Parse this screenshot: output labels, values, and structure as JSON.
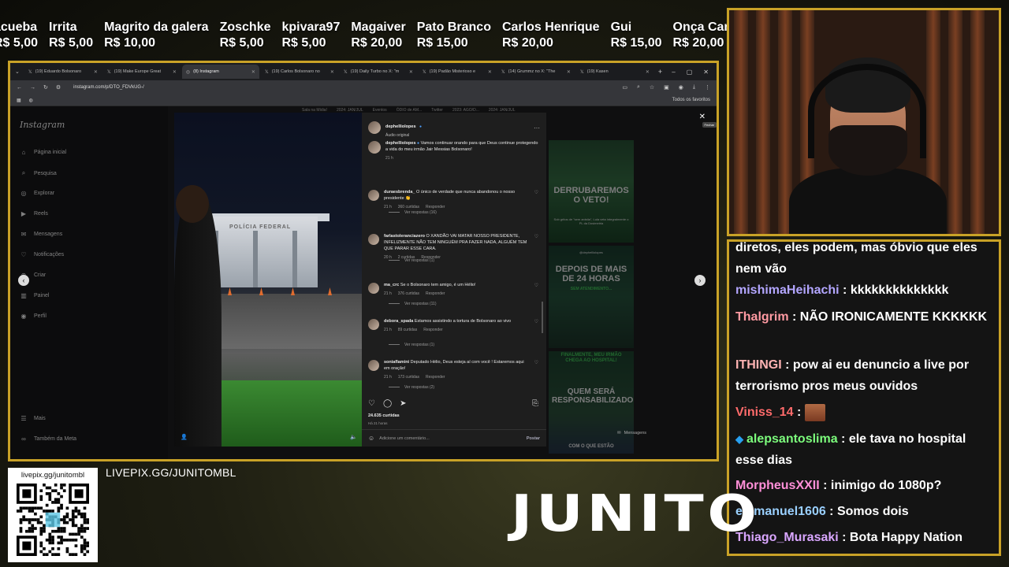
{
  "ticker": [
    {
      "name": "acueba",
      "amount": "R$ 5,00"
    },
    {
      "name": "Irrita",
      "amount": "R$ 5,00"
    },
    {
      "name": "Magrito da galera",
      "amount": "R$ 10,00"
    },
    {
      "name": "Zoschke",
      "amount": "R$ 5,00"
    },
    {
      "name": "kpivara97",
      "amount": "R$ 5,00"
    },
    {
      "name": "Magaiver",
      "amount": "R$ 20,00"
    },
    {
      "name": "Pato Branco",
      "amount": "R$ 15,00"
    },
    {
      "name": "Carlos Henrique",
      "amount": "R$ 20,00"
    },
    {
      "name": "Gui",
      "amount": "R$ 15,00"
    },
    {
      "name": "Onça Canader",
      "amount": "R$ 20,00"
    }
  ],
  "browser": {
    "tabs": [
      "(19) Eduardo Bolsonaro",
      "(19) Make Europe Great",
      "(8) Instagram",
      "(19) Carlos Bolsonaro no",
      "(19) Daily Turbo no X: \"m",
      "(19) Padão Misterioso e",
      "(14) Grummz no X: \"The",
      "(19) Kasen"
    ],
    "url": "instagram.com/p/DTO_FDVkUG-/",
    "bookmarks_right": "Todos os favoritos"
  },
  "instagram": {
    "logo": "Instagram",
    "nav": [
      "Página inicial",
      "Pesquisa",
      "Explorar",
      "Reels",
      "Mensagens",
      "Notificações",
      "Criar",
      "Painel",
      "Perfil",
      "Mais",
      "Também da Meta"
    ],
    "bg_topbar": [
      "Sala na Mídia!",
      "2024: JAN/JUL",
      "Eventos",
      "ÓDIO de AM...",
      "Twitter",
      "2023: AGO/D...",
      "2024: JAN/JUL"
    ],
    "video_sign": "POLÍCIA FEDERAL",
    "post": {
      "author": "dephelliolopes",
      "audio": "Áudio original",
      "caption_user": "dephelliolopes",
      "caption": "Vamos continuar orando para que Deus continue protegendo a vida do meu irmão Jair Messias Bolsonaro!",
      "caption_time": "21 h",
      "comments": [
        {
          "user": "duraesbrenda_",
          "text": "O único de verdade que nunca abandonou o nosso presidente 👏",
          "time": "21 h",
          "likes": "360 curtidas",
          "reply": "Responder",
          "replies": "Ver respostas (16)"
        },
        {
          "user": "farlastoleranciazero",
          "text": "O XANDÃO VAI MATAR NOSSO PRESIDENTE, INFELIZMENTE NÃO TEM NINGUÉM PRA FAZER NADA, ALGUÉM TEM QUE PARAR ESSE CARA.",
          "time": "20 h",
          "likes": "2 curtidas",
          "reply": "Responder",
          "replies": "Ver respostas (1)"
        },
        {
          "user": "ma_crc",
          "text": "Se o Bolsonaro tem amigo, é um Hélio!",
          "time": "21 h",
          "likes": "376 curtidas",
          "reply": "Responder",
          "replies": "Ver respostas (11)"
        },
        {
          "user": "debora_spada",
          "text": "Estamos assistindo a tortura de Bolsonaro ao vivo",
          "time": "21 h",
          "likes": "89 curtidas",
          "reply": "Responder",
          "replies": "Ver respostas (1)"
        },
        {
          "user": "soniaflamini",
          "text": "Deputado Hélio, Deus esteja aí com você ! Estaremos aqui em oração!",
          "time": "21 h",
          "likes": "173 curtidas",
          "reply": "Responder",
          "replies": "Ver respostas (2)"
        }
      ],
      "likes_total": "24.635 curtidas",
      "posted": "Há 21 horas",
      "comment_placeholder": "Adicione um comentário...",
      "post_button": "Postar",
      "close_tooltip": "Fechar"
    },
    "right_posts": {
      "p1_title": "DERRUBAREMOS O VETO!",
      "p1_sub": "Sob gritos de \"sem anistia\", Lula veta integralmente o PL da Dosimetria",
      "p2_handle": "@dephelliolopes",
      "p2_title": "DEPOIS DE MAIS DE 24 HORAS",
      "p2_sub": "SEM ATENDIMENTO...",
      "p3_title": "FINALMENTE, MEU IRMÃO CHEGA AO HOSPITAL!",
      "p3_big": "QUEM SERÁ RESPONSABILIZADO",
      "p3_bottom": "COM O QUE ESTÃO"
    },
    "messages_label": "Mensagens"
  },
  "chat": [
    {
      "user": "",
      "color": "#ffffff",
      "text": "diretos, eles podem, mas óbvio que eles nem vão"
    },
    {
      "user": "mishimaHeihachi",
      "color": "#b3a6ff",
      "text": "kkkkkkkkkkkkkk"
    },
    {
      "user": "Thalgrim",
      "color": "#ff9aa2",
      "text": "NÃO IRONICAMENTE KKKKKK"
    },
    {
      "user": "ITHINGI",
      "color": "#ffb3b3",
      "text": "pow ai eu denuncio a live por terrorismo pros meus ouvidos"
    },
    {
      "user": "Viniss_14",
      "color": "#ff6b6b",
      "text": ""
    },
    {
      "user": "alepsantoslima",
      "color": "#7cfc7c",
      "text": "ele tava no hospital esse dias"
    },
    {
      "user": "MorpheusXXII",
      "color": "#ff8fd8",
      "text": "inimigo do 1080p?"
    },
    {
      "user": "emmanuel1606",
      "color": "#9ad0ff",
      "text": "Somos dois"
    },
    {
      "user": "Thiago_Murasaki",
      "color": "#d9a6ff",
      "text": "Bota Happy Nation"
    }
  ],
  "qr": {
    "label": "livepix.gg/junitombl"
  },
  "livepix_url": "LIVEPIX.GG/JUNITOMBL",
  "brand": "JUNITO"
}
